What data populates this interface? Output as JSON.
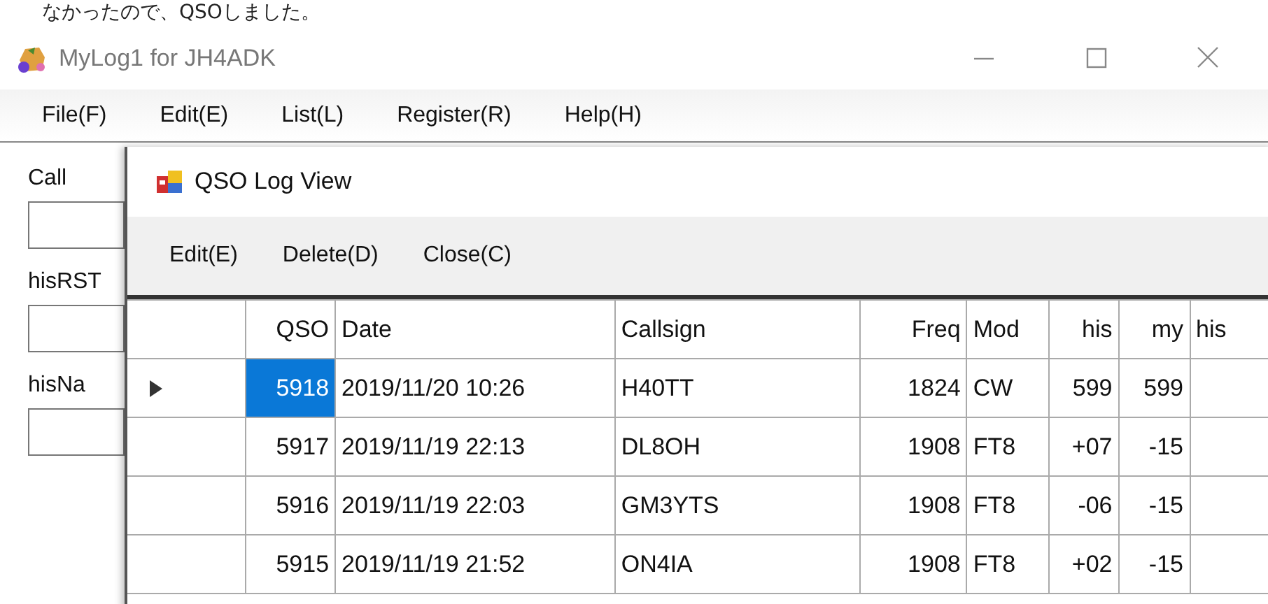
{
  "caption_text": "なかったので、QSOしました。",
  "window": {
    "title": "MyLog1 for JH4ADK"
  },
  "menu": [
    "File(F)",
    "Edit(E)",
    "List(L)",
    "Register(R)",
    "Help(H)"
  ],
  "form": {
    "fields": [
      {
        "label": "Call"
      },
      {
        "label": "hisRST"
      },
      {
        "label": "hisNa"
      }
    ]
  },
  "dialog": {
    "title": "QSO Log View",
    "toolbar": [
      "Edit(E)",
      "Delete(D)",
      "Close(C)"
    ],
    "table": {
      "columns": [
        "QSO",
        "Date",
        "Callsign",
        "Freq",
        "Mod",
        "his",
        "my",
        "his"
      ],
      "rows": [
        {
          "selected": true,
          "cells": [
            "5918",
            "2019/11/20 10:26",
            "H40TT",
            "1824",
            "CW",
            "599",
            "599"
          ]
        },
        {
          "selected": false,
          "cells": [
            "5917",
            "2019/11/19 22:13",
            "DL8OH",
            "1908",
            "FT8",
            "+07",
            "-15"
          ]
        },
        {
          "selected": false,
          "cells": [
            "5916",
            "2019/11/19 22:03",
            "GM3YTS",
            "1908",
            "FT8",
            "-06",
            "-15"
          ]
        },
        {
          "selected": false,
          "cells": [
            "5915",
            "2019/11/19 21:52",
            "ON4IA",
            "1908",
            "FT8",
            "+02",
            "-15"
          ]
        }
      ]
    }
  }
}
